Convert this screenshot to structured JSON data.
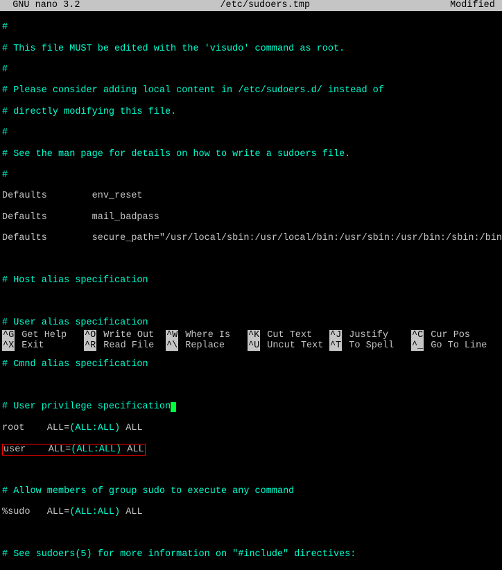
{
  "header": {
    "left": "  GNU nano 3.2",
    "center": "/etc/sudoers.tmp",
    "right": "Modified "
  },
  "lines": {
    "l1": "#",
    "l2": "# This file MUST be edited with the 'visudo' command as root.",
    "l3": "#",
    "l4": "# Please consider adding local content in /etc/sudoers.d/ instead of",
    "l5": "# directly modifying this file.",
    "l6": "#",
    "l7": "# See the man page for details on how to write a sudoers file.",
    "l8": "#",
    "l9a": "Defaults        env_reset",
    "l9b": "Defaults        mail_badpass",
    "l9c": "Defaults        secure_path=\"/usr/local/sbin:/usr/local/bin:/usr/sbin:/usr/bin:/sbin:/bin\"",
    "l10": "# Host alias specification",
    "l11": "# User alias specification",
    "l12": "# Cmnd alias specification",
    "l13": "# User privilege specification",
    "l14": "root    ALL=",
    "l14b": "(ALL:ALL)",
    "l14c": " ALL",
    "l15a": "user    ALL=",
    "l15b": "(ALL:ALL)",
    "l15c": " ALL",
    "l16": "# Allow members of group sudo to execute any command",
    "l17a": "%sudo   ALL=",
    "l17b": "(ALL:ALL)",
    "l17c": " ALL",
    "l18": "# See sudoers(5) for more information on \"#include\" directives:"
  },
  "shortcuts": {
    "row1": [
      {
        "key": "^G",
        "desc": "Get Help"
      },
      {
        "key": "^O",
        "desc": "Write Out"
      },
      {
        "key": "^W",
        "desc": "Where Is"
      },
      {
        "key": "^K",
        "desc": "Cut Text"
      },
      {
        "key": "^J",
        "desc": "Justify"
      },
      {
        "key": "^C",
        "desc": "Cur Pos"
      }
    ],
    "row2": [
      {
        "key": "^X",
        "desc": "Exit"
      },
      {
        "key": "^R",
        "desc": "Read File"
      },
      {
        "key": "^\\",
        "desc": "Replace"
      },
      {
        "key": "^U",
        "desc": "Uncut Text"
      },
      {
        "key": "^T",
        "desc": "To Spell"
      },
      {
        "key": "^_",
        "desc": "Go To Line"
      }
    ]
  }
}
